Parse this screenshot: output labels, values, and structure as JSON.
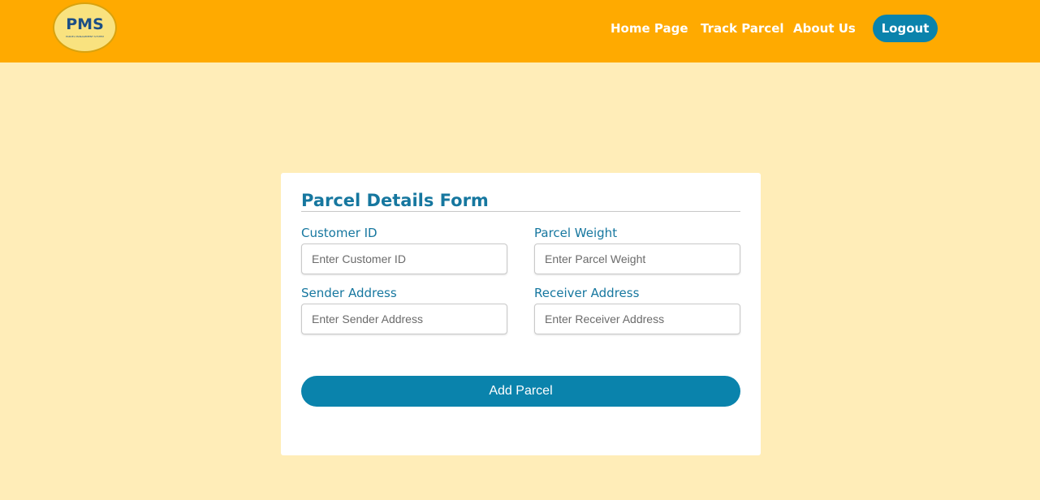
{
  "navbar": {
    "logo": {
      "text": "PMS",
      "subtext": "PARCEL MANAGEMENT SYSTEM"
    },
    "links": {
      "home": "Home Page",
      "track": "Track Parcel",
      "about": "About Us"
    },
    "logout_label": "Logout"
  },
  "form": {
    "title": "Parcel Details Form",
    "fields": {
      "customer_id": {
        "label": "Customer ID",
        "placeholder": "Enter Customer ID",
        "value": ""
      },
      "parcel_weight": {
        "label": "Parcel Weight",
        "placeholder": "Enter Parcel Weight",
        "value": ""
      },
      "sender_address": {
        "label": "Sender Address",
        "placeholder": "Enter Sender Address",
        "value": ""
      },
      "receiver_address": {
        "label": "Receiver Address",
        "placeholder": "Enter Receiver Address",
        "value": ""
      }
    },
    "submit_label": "Add Parcel"
  },
  "colors": {
    "navbar_bg": "#FFAA00",
    "page_bg": "#FFEDB8",
    "accent": "#0A83AC",
    "label": "#16779F",
    "card_bg": "#FFFFFF"
  }
}
